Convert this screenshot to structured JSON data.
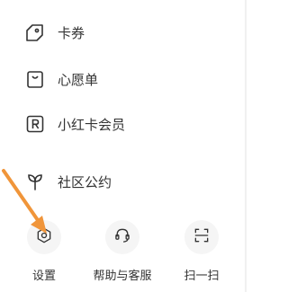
{
  "menu": {
    "items": [
      {
        "label": "卡券",
        "icon": "coupon-icon"
      },
      {
        "label": "心愿单",
        "icon": "wishlist-bag-icon"
      },
      {
        "label": "小红卡会员",
        "icon": "member-card-icon"
      },
      {
        "label": "社区公约",
        "icon": "sprout-icon"
      }
    ]
  },
  "bottom_bar": {
    "items": [
      {
        "label": "设置",
        "icon": "gear-icon"
      },
      {
        "label": "帮助与客服",
        "icon": "headset-icon"
      },
      {
        "label": "扫一扫",
        "icon": "scan-icon"
      }
    ]
  },
  "colors": {
    "text": "#333333",
    "circle_bg": "#f5f5f5",
    "annotation_arrow": "#f0953a"
  }
}
